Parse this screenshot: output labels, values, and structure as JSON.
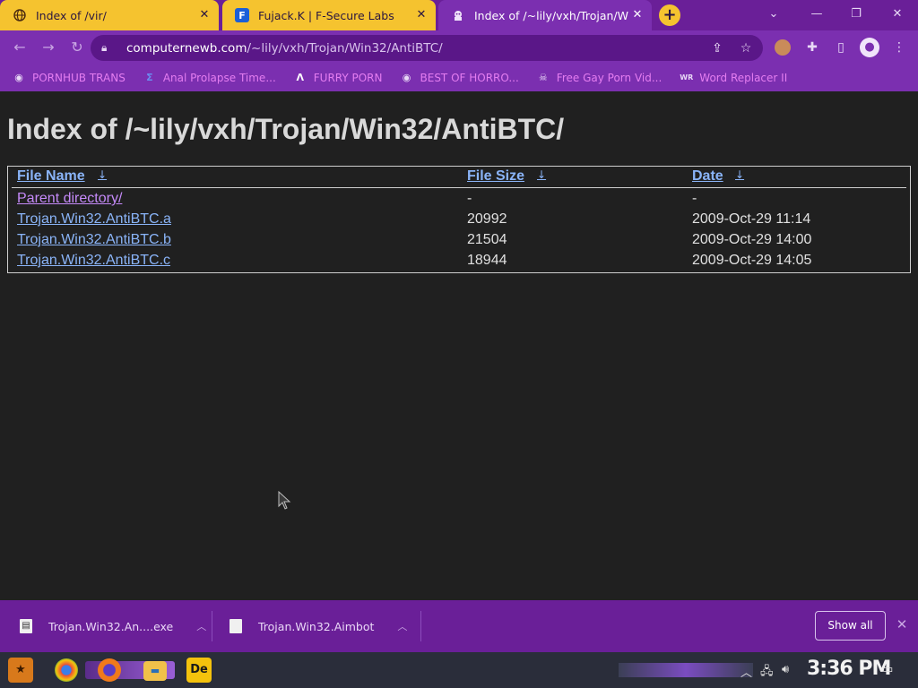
{
  "tabs": [
    {
      "title": "Index of /vir/",
      "favicon": "globe-icon"
    },
    {
      "title": "Fujack.K | F-Secure Labs",
      "favicon": "f-secure-icon"
    },
    {
      "title": "Index of /~lily/vxh/Trojan/W",
      "favicon": "mascot-icon"
    }
  ],
  "omnibox": {
    "host": "computernewb.com",
    "path": "/~lily/vxh/Trojan/Win32/AntiBTC/"
  },
  "bookmarks": [
    {
      "label": "PORNHUB TRANS",
      "icon": "globe-icon"
    },
    {
      "label": "Anal Prolapse Time...",
      "icon": "bracket-icon"
    },
    {
      "label": "FURRY PORN",
      "icon": "lambda-icon"
    },
    {
      "label": "BEST OF HORRO...",
      "icon": "globe-icon"
    },
    {
      "label": "Free Gay Porn Vid...",
      "icon": "skull-icon"
    },
    {
      "label": "Word Replacer II",
      "icon": "wr-icon"
    }
  ],
  "page": {
    "title": "Index of /~lily/vxh/Trojan/Win32/AntiBTC/",
    "columns": [
      "File Name",
      "File Size",
      "Date"
    ],
    "sort_indicator": "↓",
    "rows": [
      {
        "name": "Parent directory/",
        "size": "-",
        "date": "-"
      },
      {
        "name": "Trojan.Win32.AntiBTC.a",
        "size": "20992",
        "date": "2009-Oct-29 11:14"
      },
      {
        "name": "Trojan.Win32.AntiBTC.b",
        "size": "21504",
        "date": "2009-Oct-29 14:00"
      },
      {
        "name": "Trojan.Win32.AntiBTC.c",
        "size": "18944",
        "date": "2009-Oct-29 14:05"
      }
    ]
  },
  "downloads": {
    "items": [
      {
        "name": "Trojan.Win32.An....exe",
        "icon": "exe-file-icon"
      },
      {
        "name": "Trojan.Win32.Aimbot",
        "icon": "file-icon"
      }
    ],
    "show_all_label": "Show all"
  },
  "taskbar": {
    "clock": "3:36 PM",
    "apps": [
      "start-icon",
      "chrome-icon",
      "firefox-icon",
      "file-explorer-icon",
      "de-icon"
    ]
  },
  "colors": {
    "tab_bar": "#6a1f98",
    "toolbar": "#7b2fb0",
    "inactive_tab": "#f5c32f",
    "bookmark_text": "#e47df0",
    "page_bg": "#202020",
    "link": "#8ab4f8",
    "visited_link": "#c58af9"
  }
}
